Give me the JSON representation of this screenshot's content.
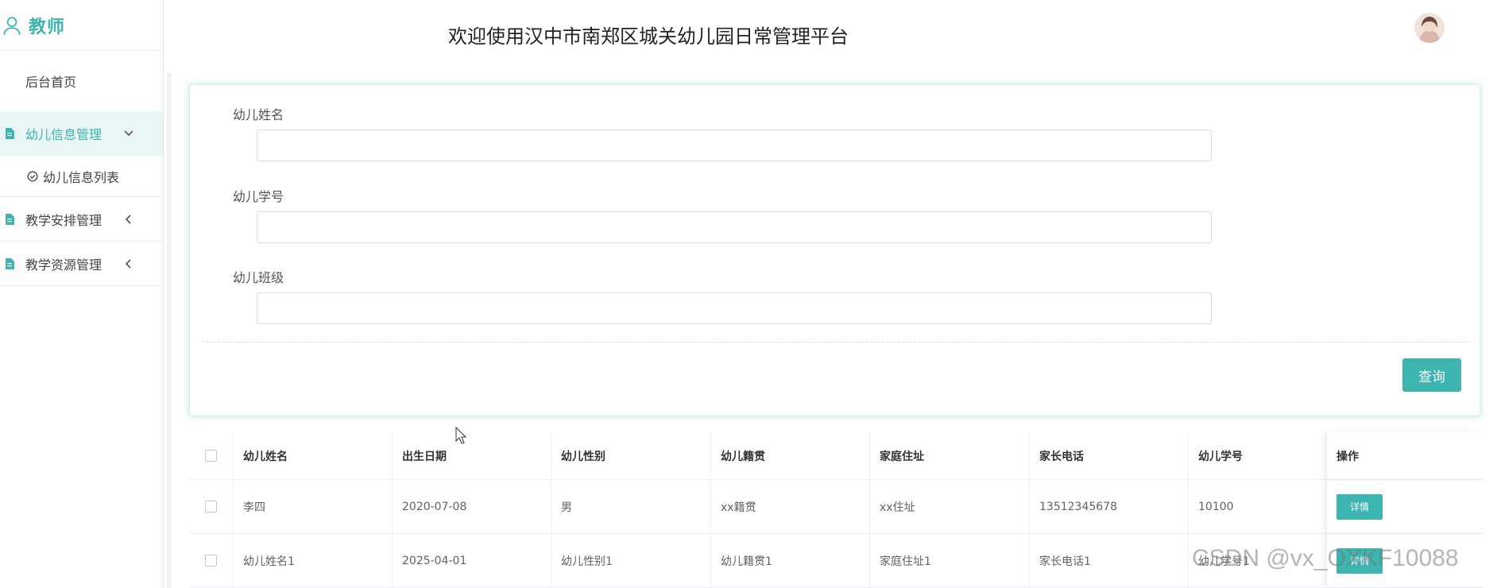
{
  "sidebar": {
    "brand": "教师",
    "home": "后台首页",
    "menus": [
      {
        "label": "幼儿信息管理"
      },
      {
        "label": "教学安排管理"
      },
      {
        "label": "教学资源管理"
      }
    ],
    "submenu": {
      "label": "幼儿信息列表"
    }
  },
  "header": {
    "title": "欢迎使用汉中市南郑区城关幼儿园日常管理平台"
  },
  "search": {
    "fields": [
      {
        "label": "幼儿姓名",
        "value": ""
      },
      {
        "label": "幼儿学号",
        "value": ""
      },
      {
        "label": "幼儿班级",
        "value": ""
      }
    ],
    "query_label": "查询"
  },
  "table": {
    "headers": [
      "幼儿姓名",
      "出生日期",
      "幼儿性别",
      "幼儿籍贯",
      "家庭住址",
      "家长电话",
      "幼儿学号",
      "操作"
    ],
    "rows": [
      [
        "李四",
        "2020-07-08",
        "男",
        "xx籍贯",
        "xx住址",
        "13512345678",
        "10100"
      ],
      [
        "幼儿姓名1",
        "2025-04-01",
        "幼儿性别1",
        "幼儿籍贯1",
        "家庭住址1",
        "家长电话1",
        "幼儿学号1"
      ]
    ],
    "action_label": "详情"
  },
  "watermark": "CSDN @vx_OXKF10088",
  "colors": {
    "accent": "#3cb4b0",
    "active_bg": "#e9f6f5"
  },
  "icons": [
    "user-icon",
    "document-icon",
    "chevron-down-icon",
    "chevron-left-icon",
    "check-circle-icon",
    "avatar"
  ]
}
